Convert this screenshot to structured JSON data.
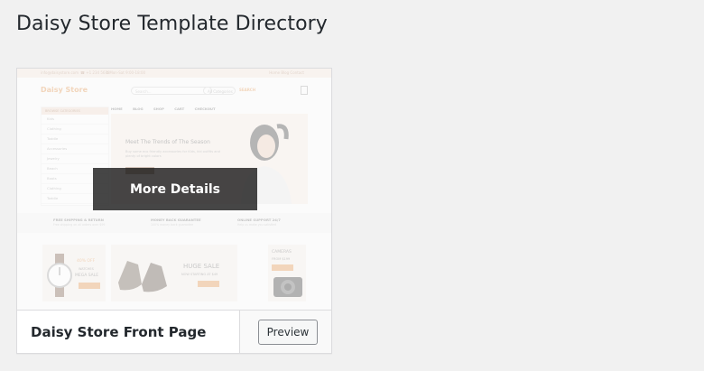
{
  "page": {
    "title": "Daisy Store Template Directory"
  },
  "template": {
    "name": "Daisy Store Front Page",
    "overlay_label": "More Details",
    "preview_label": "Preview",
    "thumbnail": {
      "logo": "Daisy Store",
      "search_placeholder": "Search...",
      "category_select": "All Categories",
      "search_button": "SEARCH",
      "browse_header": "BROWSE CATEGORIES",
      "side_items": [
        "Kids",
        "Clothing",
        "Toddle",
        "Accessories",
        "Jewelry",
        "Beach",
        "Boots",
        "Clothing",
        "Toddle"
      ],
      "nav": "HOME BLOG SHOP CART CHECKOUT",
      "hero_title": "Meet The Trends of The Season",
      "hero_text": "Buy some eco friendly accessories for Kids, kid outfits and plenty of bright colors",
      "features": [
        {
          "title": "FREE SHIPPING & RETURN",
          "sub": "Free shipping on all orders over $99"
        },
        {
          "title": "MONEY BACK GUARANTEE",
          "sub": "100% money back guarantee"
        },
        {
          "title": "ONLINE SUPPORT 24/7",
          "sub": "Help us make you satisfied"
        }
      ],
      "banners": {
        "watch_pct": "40% OFF",
        "watch_sub": "WATCHES",
        "watch_sale": "MEGA SALE",
        "shoes_title": "HUGE SALE",
        "shoes_sub": "NOW STARTING AT $49",
        "camera_title": "CAMERAS",
        "camera_sub": "FROM $199",
        "shop_now": "SHOP NOW"
      }
    }
  },
  "colors": {
    "accent": "#e08a3c",
    "overlay": "#000000",
    "bg": "#f1f1f1"
  }
}
